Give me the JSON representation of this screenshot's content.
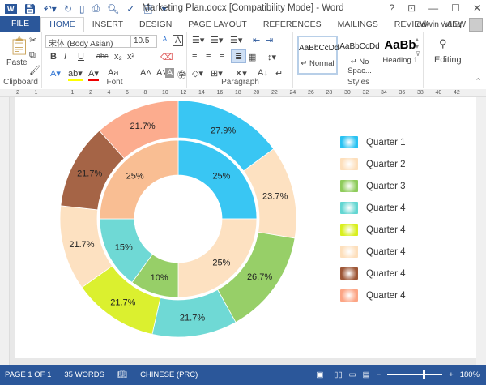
{
  "titlebar": {
    "title": "Marketing Plan.docx [Compatibility Mode] - Word",
    "help": "?",
    "minimize": "—",
    "maximize": "☐",
    "close": "✕"
  },
  "tabs": [
    "FILE",
    "HOME",
    "INSERT",
    "DESIGN",
    "PAGE LAYOUT",
    "REFERENCES",
    "MAILINGS",
    "REVIEW",
    "VIEW"
  ],
  "user": "edwin wang",
  "ribbon": {
    "clipboard": {
      "label": "Clipboard",
      "paste": "Paste"
    },
    "font": {
      "label": "Font",
      "font_name": "宋体 (Body Asian)",
      "font_size": "10.5",
      "bold": "B",
      "italic": "I",
      "underline": "U",
      "strike": "abc",
      "sub": "x₂",
      "sup": "x²",
      "grow": "A˄",
      "shrink": "A˅",
      "case": "Aa"
    },
    "paragraph": {
      "label": "Paragraph"
    },
    "styles": {
      "label": "Styles",
      "items": [
        {
          "preview": "AaBbCcDd",
          "name": "↵ Normal"
        },
        {
          "preview": "AaBbCcDd",
          "name": "↵ No Spac..."
        },
        {
          "preview": "AaBb",
          "name": "Heading 1"
        }
      ]
    },
    "editing": {
      "label": "Editing"
    }
  },
  "ruler": [
    "2",
    "1",
    "",
    "1",
    "2",
    "4",
    "6",
    "8",
    "10",
    "12",
    "14",
    "16",
    "18",
    "20",
    "22",
    "24",
    "26",
    "28",
    "30",
    "32",
    "34",
    "36",
    "38",
    "40",
    "42"
  ],
  "chart_data": {
    "type": "pie",
    "subtype": "doughnut",
    "series": [
      {
        "name": "outer",
        "values": [
          27.9,
          23.7,
          26.7,
          21.7,
          21.7,
          21.7,
          21.7,
          21.7
        ],
        "labels": [
          "27.9%",
          "23.7%",
          "26.7%",
          "21.7%",
          "21.7%",
          "21.7%",
          "21.7%",
          "21.7%"
        ]
      },
      {
        "name": "inner",
        "values": [
          25,
          25,
          10,
          15,
          25
        ],
        "labels": [
          "25%",
          "25%",
          "10%",
          "15%",
          "25%"
        ]
      }
    ],
    "outer_colors": [
      "#29C2F2",
      "#FDDFBC",
      "#8FCC5C",
      "#63D6D2",
      "#D9EF1E",
      "#FDDFBC",
      "#9E5737",
      "#FCA585"
    ],
    "inner_colors": [
      "#29C2F2",
      "#FDDFBC",
      "#8FCC5C",
      "#63D6D2",
      "#F9B98A"
    ],
    "legend": [
      "Quarter 1",
      "Quarter 2",
      "Quarter 3",
      "Quarter 4",
      "Quarter 4",
      "Quarter 4",
      "Quarter 4",
      "Quarter 4"
    ],
    "legend_position": "right"
  },
  "status": {
    "page": "PAGE 1 OF 1",
    "words": "35 WORDS",
    "language": "CHINESE (PRC)",
    "zoom": "180%",
    "zoom_level": 180
  }
}
